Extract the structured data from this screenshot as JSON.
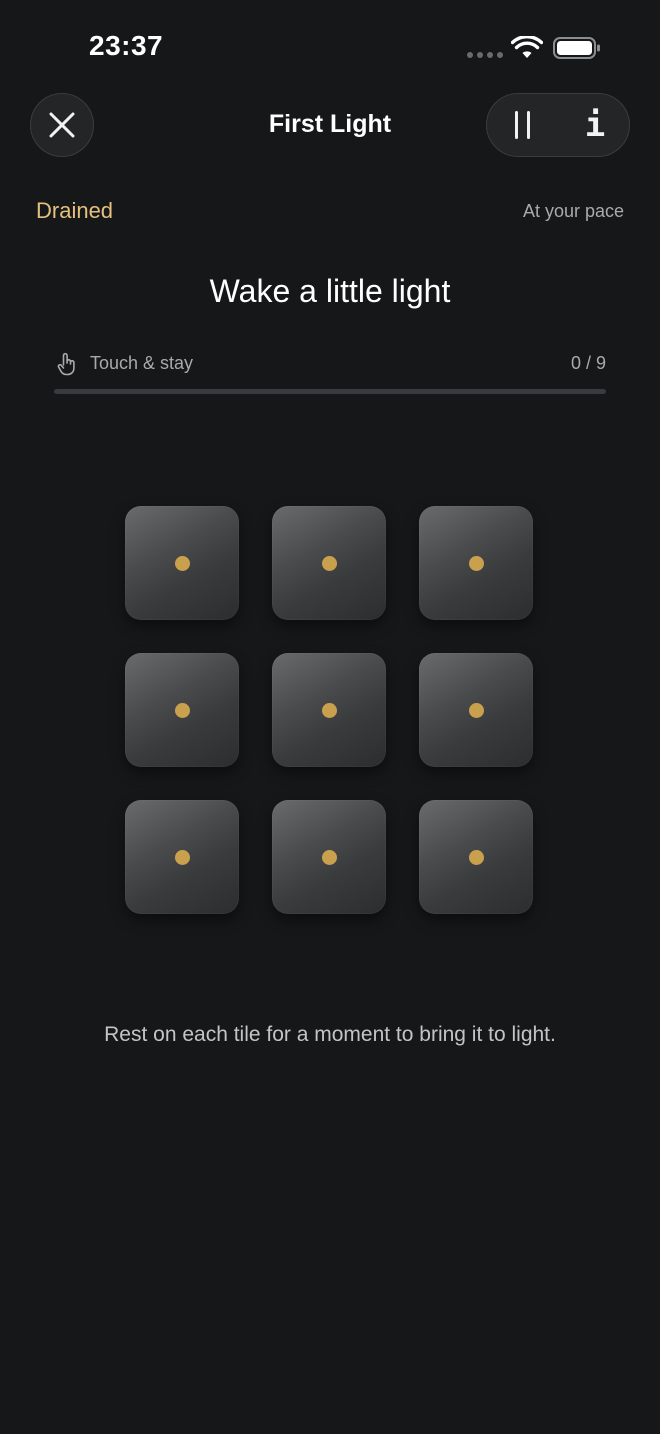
{
  "status_bar": {
    "time": "23:37",
    "signal": "signal-dots-icon",
    "wifi": "wifi-icon",
    "battery": "battery-icon"
  },
  "header": {
    "title": "First Light",
    "close_icon": "close-icon",
    "pause_icon": "pause-icon",
    "info_icon": "info-icon",
    "info_glyph": "i"
  },
  "session": {
    "state": "Drained",
    "pace": "At your pace"
  },
  "task": {
    "title": "Wake a little light",
    "mode_icon": "hand-pointer-icon",
    "mode_label": "Touch & stay",
    "progress_text": "0 / 9",
    "progress_fraction": 0
  },
  "tiles": [
    {
      "lit": false
    },
    {
      "lit": false
    },
    {
      "lit": false
    },
    {
      "lit": false
    },
    {
      "lit": false
    },
    {
      "lit": false
    },
    {
      "lit": false
    },
    {
      "lit": false
    },
    {
      "lit": false
    }
  ],
  "hint": "Rest on each tile for a moment to bring it to light.",
  "colors": {
    "background": "#161719",
    "accent_gold": "#e5c07e",
    "tile_dot": "#c9a04e",
    "muted_text": "#a9aaac"
  }
}
